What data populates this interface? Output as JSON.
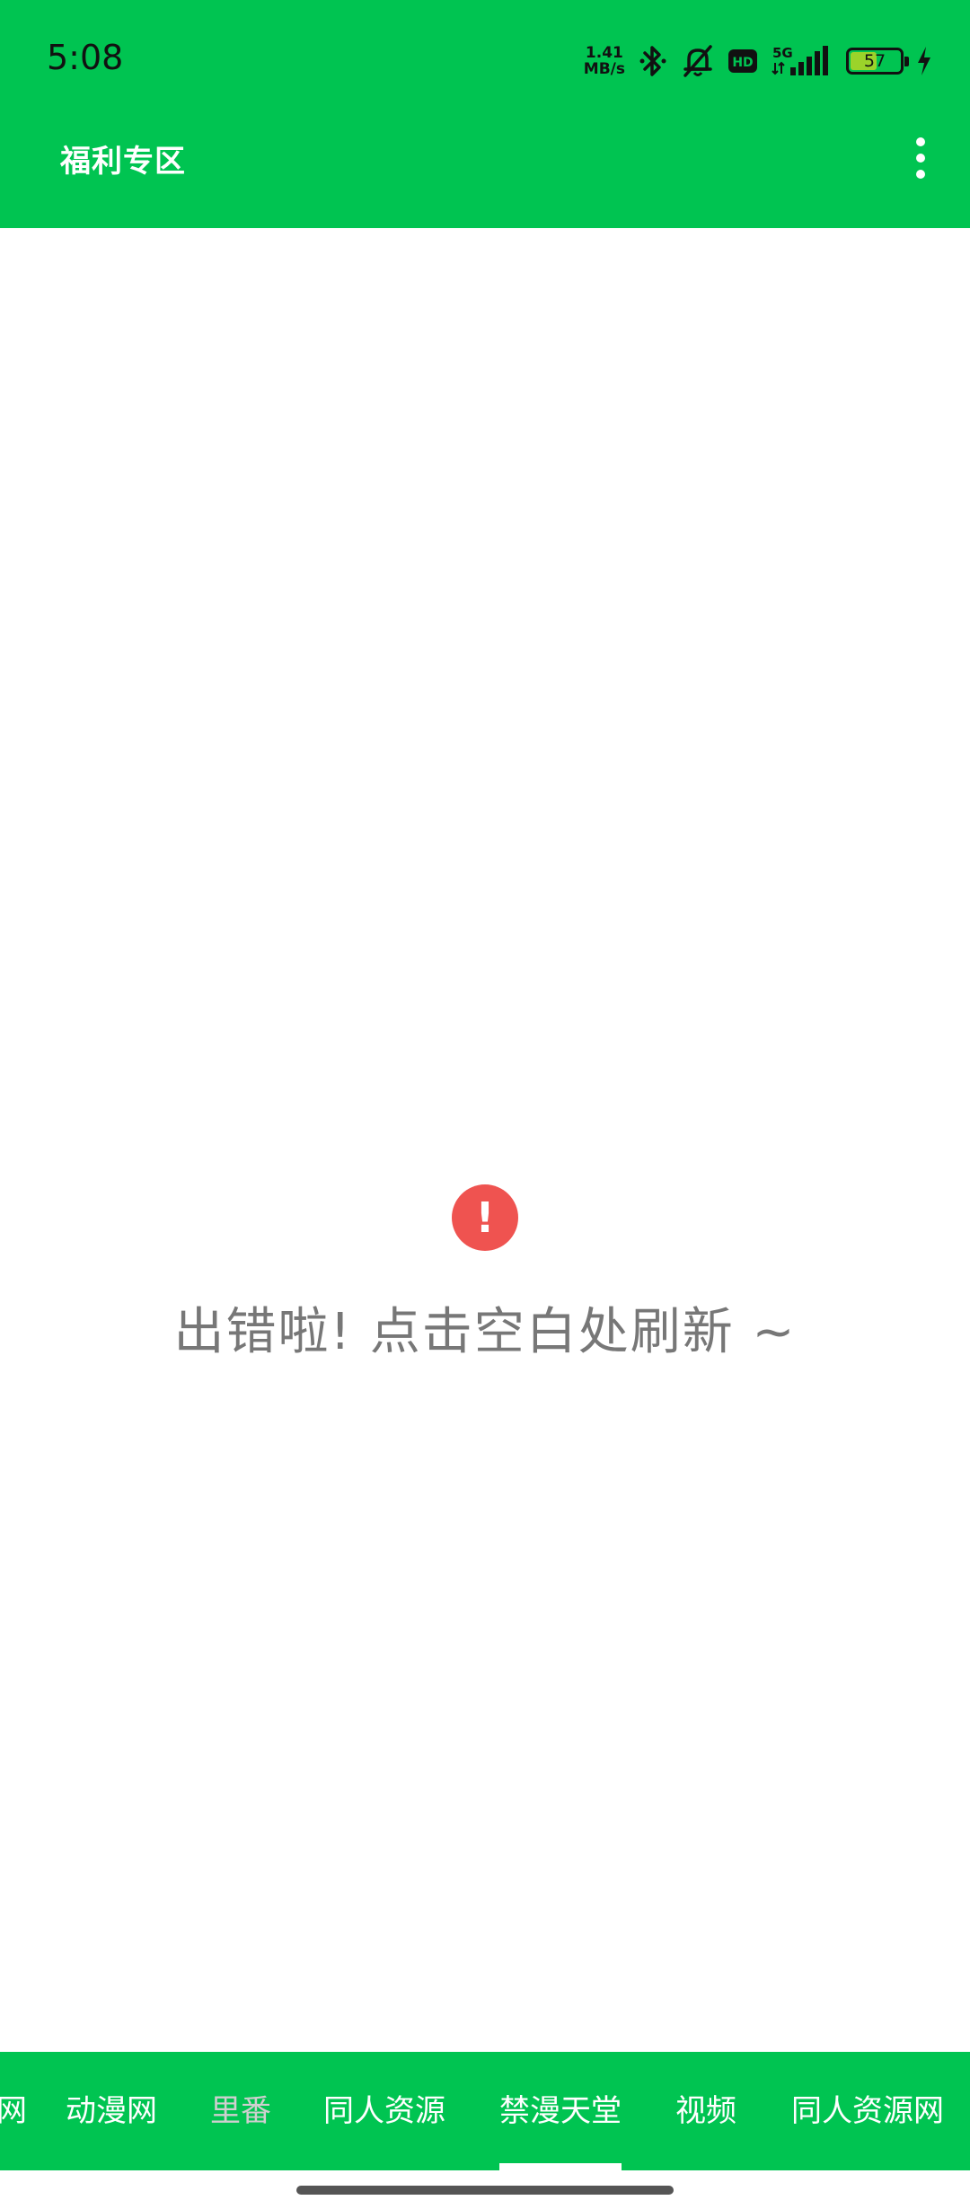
{
  "status_bar": {
    "time": "5:08",
    "net_speed_value": "1.41",
    "net_speed_unit": "MB/s",
    "icons": [
      "bluetooth-icon",
      "bell-muted-icon",
      "hd-icon",
      "5g-signal-icon"
    ],
    "network_label": "5G",
    "hd_label": "HD",
    "battery_level": "57",
    "battery_color": "#9bd32a",
    "charging": true
  },
  "app_bar": {
    "title": "福利专区",
    "background": "#00c451"
  },
  "error": {
    "icon_glyph": "!",
    "icon_color": "#ef5350",
    "message": "出错啦! 点击空白处刷新 ~"
  },
  "tabs": {
    "items": [
      {
        "label": "网"
      },
      {
        "label": "动漫网"
      },
      {
        "label": "里番"
      },
      {
        "label": "同人资源"
      },
      {
        "label": "禁漫天堂"
      },
      {
        "label": "视频"
      },
      {
        "label": "同人资源网"
      }
    ],
    "selected_index": 4
  }
}
